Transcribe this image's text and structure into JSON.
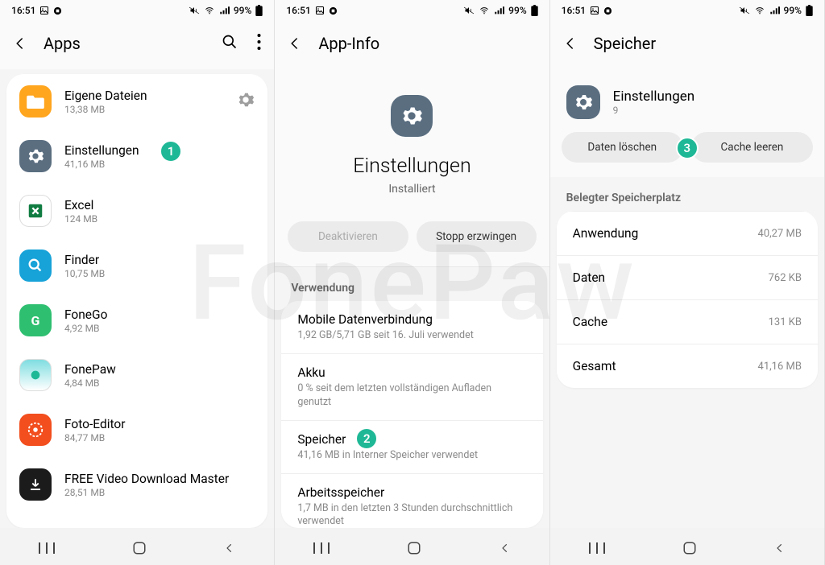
{
  "status": {
    "time": "16:51",
    "battery": "99%"
  },
  "step_badges": [
    "1",
    "2",
    "3"
  ],
  "s1": {
    "title": "Apps",
    "apps": [
      {
        "name": "Eigene Dateien",
        "size": "13,38 MB",
        "icon_bg": "#ffa51e",
        "gear": true
      },
      {
        "name": "Einstellungen",
        "size": "41,16 MB",
        "icon_bg": "#5a6e80"
      },
      {
        "name": "Excel",
        "size": "124 MB",
        "icon_bg": "#ffffff"
      },
      {
        "name": "Finder",
        "size": "10,75 MB",
        "icon_bg": "#17a2d8"
      },
      {
        "name": "FoneGo",
        "size": "4,92 MB",
        "icon_bg": "#2fbf71"
      },
      {
        "name": "FonePaw",
        "size": "4,84 MB",
        "icon_bg": "#ffffff"
      },
      {
        "name": "Foto-Editor",
        "size": "84,77 MB",
        "icon_bg": "#f24e1e"
      },
      {
        "name": "FREE Video Download Master",
        "size": "28,51 MB",
        "icon_bg": "#1b1b1b"
      }
    ]
  },
  "s2": {
    "title": "App-Info",
    "app_name": "Einstellungen",
    "status": "Installiert",
    "btn_deactivate": "Deaktivieren",
    "btn_force_stop": "Stopp erzwingen",
    "section_usage": "Verwendung",
    "items": [
      {
        "title": "Mobile Datenverbindung",
        "sub": "1,92 GB/5,71 GB seit 16. Juli verwendet"
      },
      {
        "title": "Akku",
        "sub": "0 % seit dem letzten vollständigen Aufladen genutzt"
      },
      {
        "title": "Speicher",
        "sub": "41,16 MB in Interner Speicher verwendet"
      },
      {
        "title": "Arbeitsspeicher",
        "sub": "1,7 MB in den letzten 3 Stunden durchschnittlich verwendet"
      }
    ]
  },
  "s3": {
    "title": "Speicher",
    "app_name": "Einstellungen",
    "app_version": "9",
    "btn_clear_data": "Daten löschen",
    "btn_clear_cache": "Cache leeren",
    "section_header": "Belegter Speicherplatz",
    "rows": [
      {
        "label": "Anwendung",
        "val": "40,27 MB"
      },
      {
        "label": "Daten",
        "val": "762 KB"
      },
      {
        "label": "Cache",
        "val": "131 KB"
      },
      {
        "label": "Gesamt",
        "val": "41,16 MB"
      }
    ]
  },
  "watermark": "FonePaw"
}
